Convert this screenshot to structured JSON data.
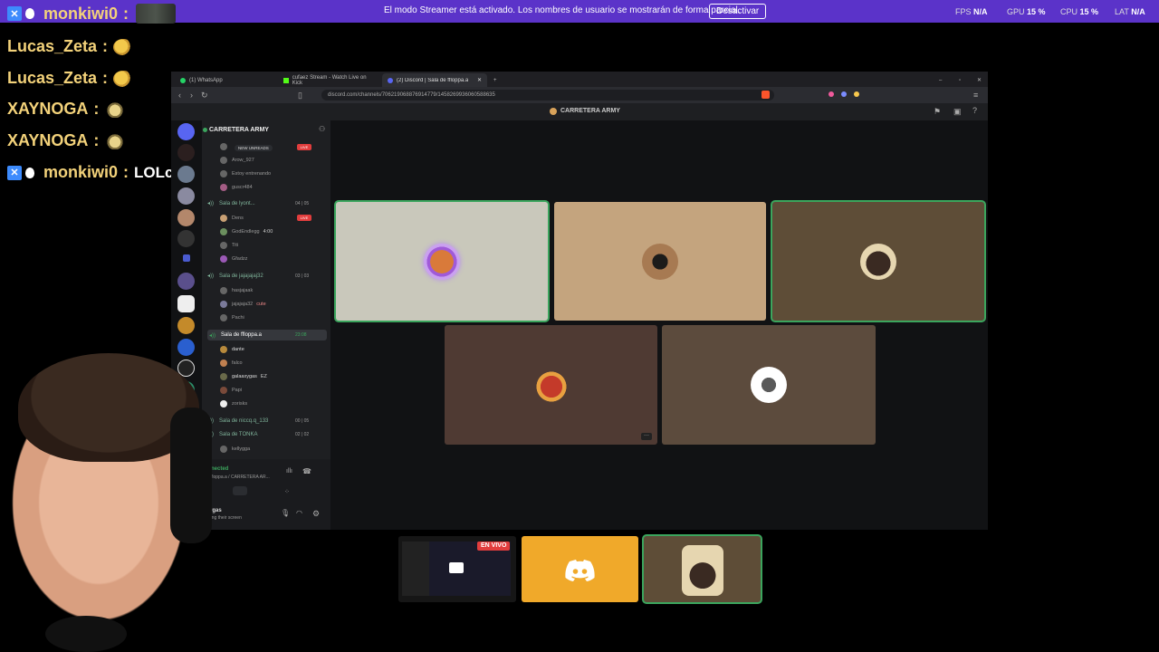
{
  "banner": {
    "message": "El modo Streamer está activado. Los nombres de usuario se mostrarán de forma parcial.",
    "button": "Desactivar",
    "fps_label": "FPS",
    "fps_value": "N/A",
    "gpu_label": "GPU",
    "gpu_value": "15 %",
    "cpu_label": "CPU",
    "cpu_value": "15 %",
    "lat_label": "LAT",
    "lat_value": "N/A"
  },
  "chat": [
    {
      "user": "monkiwi0",
      "msg": "",
      "emote": "cat-emote"
    },
    {
      "user": "Lucas_Zeta",
      "msg": "",
      "emote": "pepe-emote"
    },
    {
      "user": "Lucas_Zeta",
      "msg": "",
      "emote": "pepe-emote"
    },
    {
      "user": "XAYNOGA",
      "msg": "",
      "emote": "blob-emote"
    },
    {
      "user": "XAYNOGA",
      "msg": "",
      "emote": "blob-emote"
    },
    {
      "user": "monkiwi0",
      "msg": "LOLcooo",
      "emote": ""
    }
  ],
  "browser": {
    "tabs": [
      "(1) WhatsApp",
      "cufaez Stream - Watch Live on Kick",
      "(2) Discord | Sala de ffloppa.a"
    ],
    "url": "discord.com/channels/706219068876914779/1458269936060588635",
    "channel_title": "CARRETERA ARMY"
  },
  "sidebar": {
    "server_name": "CARRETERA ARMY",
    "new_unreads": "NEW UNREADS",
    "rows": [
      {
        "kind": "member",
        "name": "Arow_927"
      },
      {
        "kind": "member",
        "name": "Estoy entrenando"
      },
      {
        "kind": "member",
        "name": "guscr484"
      },
      {
        "kind": "voice",
        "name": "Sala de lyont...",
        "count": "04 | 05"
      },
      {
        "kind": "member",
        "name": "Dens"
      },
      {
        "kind": "member",
        "name": "GodEndlegg",
        "extra": "4:00"
      },
      {
        "kind": "member",
        "name": "Titi"
      },
      {
        "kind": "member",
        "name": "Gfadzz"
      },
      {
        "kind": "voice",
        "name": "Sala de jajajajaj32",
        "count": "03 | 03"
      },
      {
        "kind": "member",
        "name": "hasjajaak"
      },
      {
        "kind": "member",
        "name": "jajajaja32",
        "extra": "cute"
      },
      {
        "kind": "member",
        "name": "Pachi"
      },
      {
        "kind": "voice",
        "name": "Sala de ffloppa.a",
        "count": "23:08"
      },
      {
        "kind": "member",
        "name": "dante"
      },
      {
        "kind": "member",
        "name": "falco"
      },
      {
        "kind": "member",
        "name": "galaaxygas",
        "extra": "EZ"
      },
      {
        "kind": "member",
        "name": "Papi"
      },
      {
        "kind": "member",
        "name": "zorisks"
      },
      {
        "kind": "voice",
        "name": "Sala de niccq.q_133",
        "count": "00 | 05"
      },
      {
        "kind": "voice",
        "name": "Sala de TONKA",
        "count": "02 | 02"
      },
      {
        "kind": "member",
        "name": "kellygga"
      }
    ],
    "live_label": "LIVE",
    "connected_label": "nected",
    "connected_sub": "floppa.a / CARRETERA AR...",
    "user_name": "ygas",
    "user_status": "ring their screen"
  },
  "bottom": {
    "envivo": "EN VIVO"
  }
}
